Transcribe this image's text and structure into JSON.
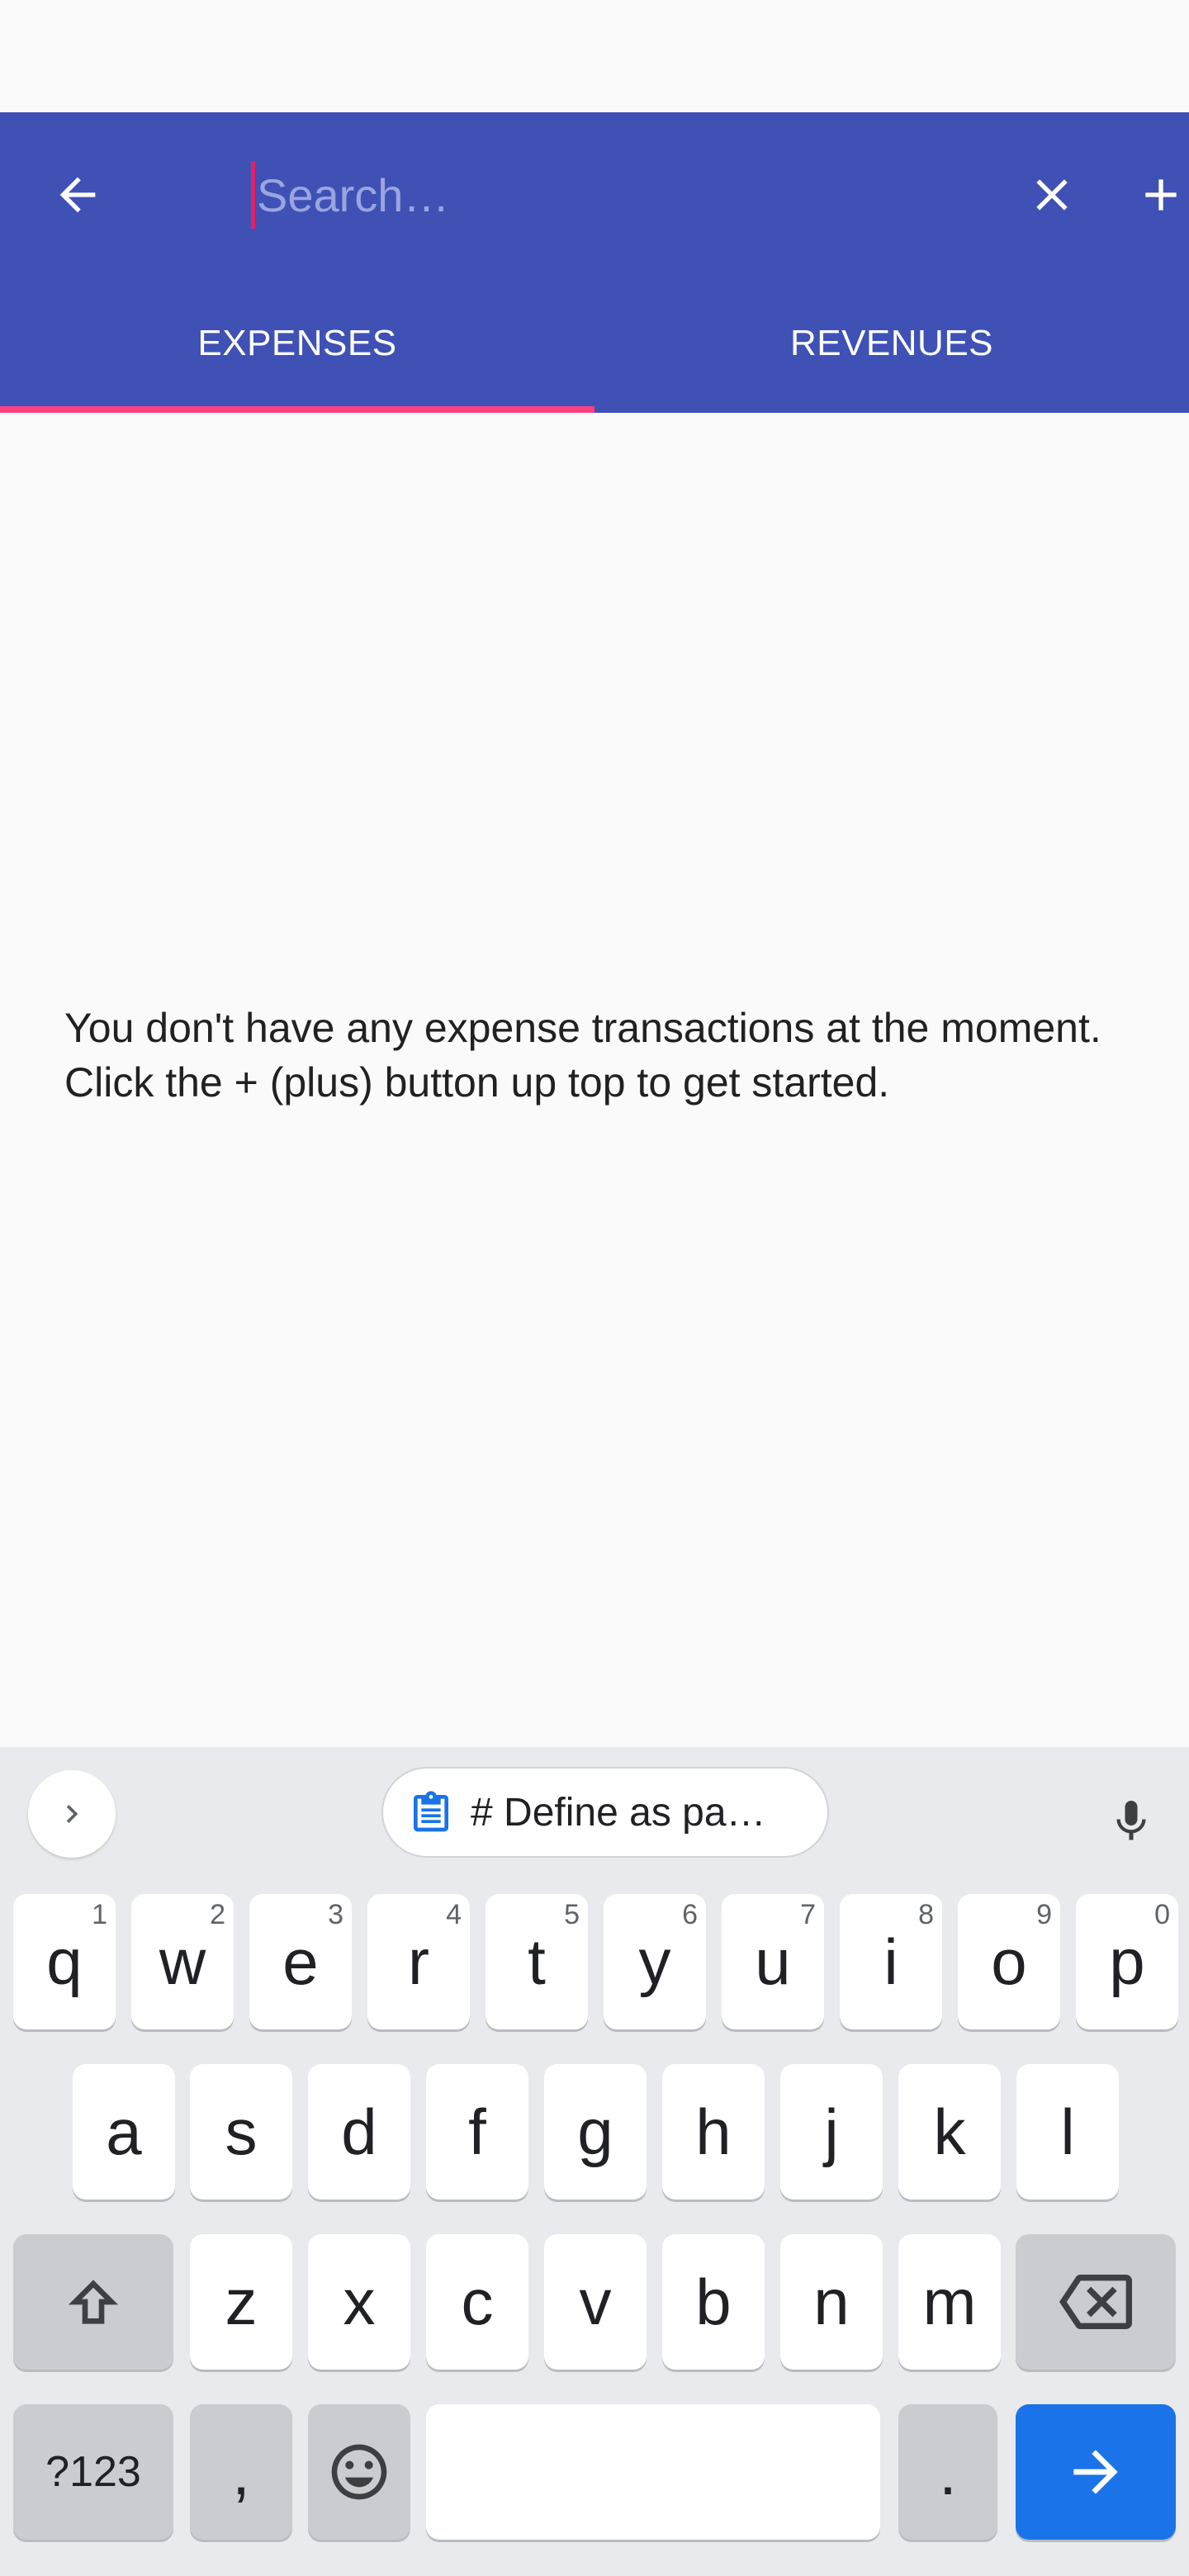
{
  "toolbar": {
    "search_placeholder": "Search…",
    "back_icon": "arrow-back-icon",
    "clear_icon": "close-icon",
    "add_icon": "plus-icon",
    "background": "#3f51b5"
  },
  "tabs": [
    {
      "label": "EXPENSES",
      "selected": true
    },
    {
      "label": "REVENUES",
      "selected": false
    }
  ],
  "tab_indicator_color": "#ff4081",
  "empty_state": {
    "message": "You don't have any expense transactions at the moment. Click the + (plus) button up top to get started."
  },
  "keyboard": {
    "suggestion_chip": "# Define as pa…",
    "row1": [
      {
        "key": "q",
        "hint": "1"
      },
      {
        "key": "w",
        "hint": "2"
      },
      {
        "key": "e",
        "hint": "3"
      },
      {
        "key": "r",
        "hint": "4"
      },
      {
        "key": "t",
        "hint": "5"
      },
      {
        "key": "y",
        "hint": "6"
      },
      {
        "key": "u",
        "hint": "7"
      },
      {
        "key": "i",
        "hint": "8"
      },
      {
        "key": "o",
        "hint": "9"
      },
      {
        "key": "p",
        "hint": "0"
      }
    ],
    "row2": [
      "a",
      "s",
      "d",
      "f",
      "g",
      "h",
      "j",
      "k",
      "l"
    ],
    "row3": [
      "z",
      "x",
      "c",
      "v",
      "b",
      "n",
      "m"
    ],
    "symbols_label": "?123",
    "comma_label": ",",
    "period_label": ".",
    "enter_color": "#1a73e8"
  }
}
